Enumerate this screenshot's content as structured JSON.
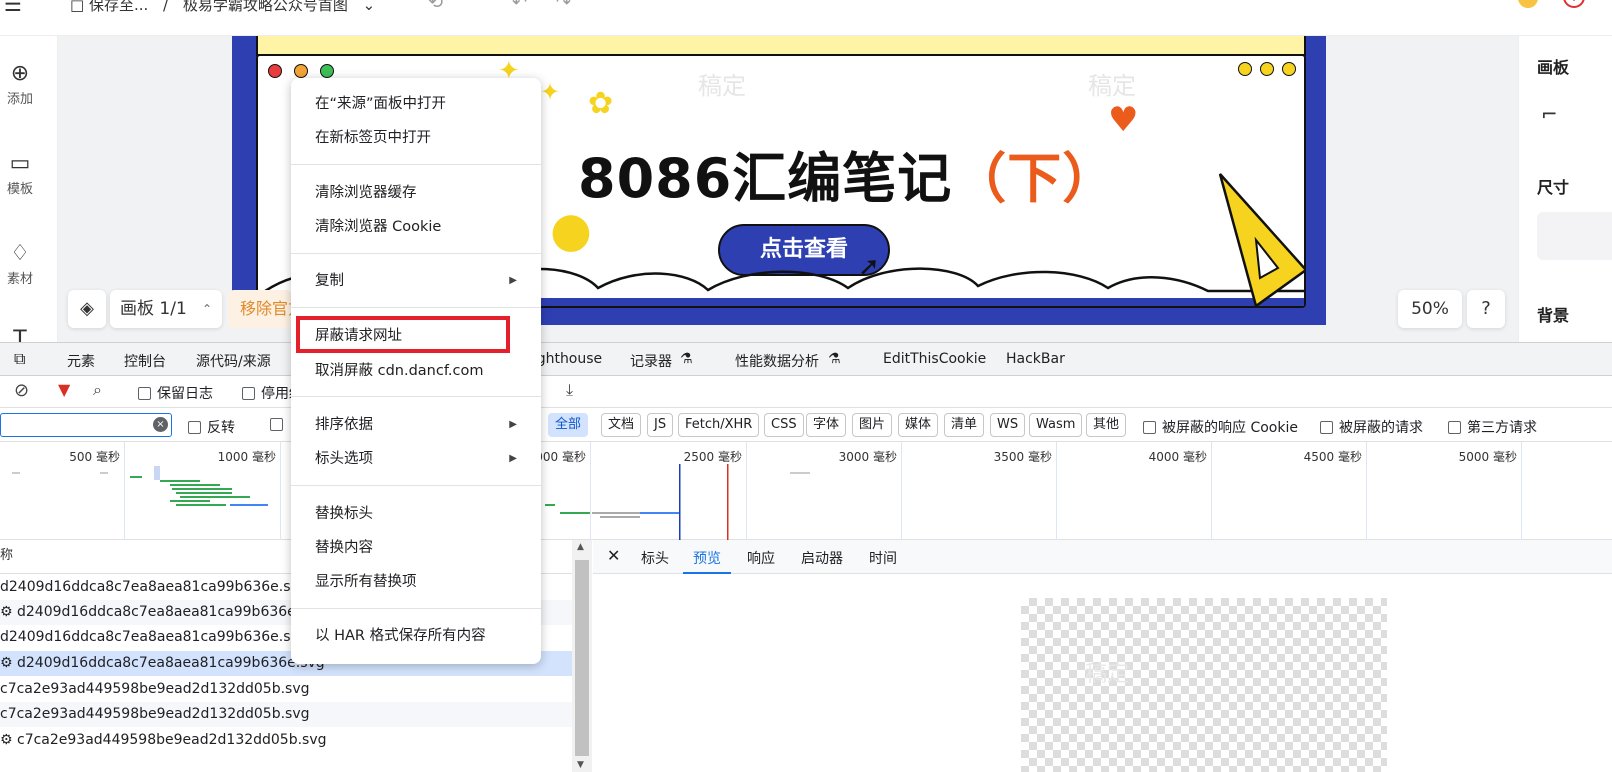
{
  "topbar": {
    "hamburger": "☰",
    "crumbs": [
      "□ 保存至...",
      "/",
      "极易学霸攻略公众号首图",
      "⌄"
    ]
  },
  "leftbar": {
    "items": [
      {
        "icon": "⊕",
        "label": "添加"
      },
      {
        "icon": "▭",
        "label": "模板"
      },
      {
        "icon": "♢",
        "label": "素材"
      },
      {
        "icon": "T",
        "label": ""
      }
    ]
  },
  "rightbar": {
    "panel": "画板",
    "size": "尺寸",
    "background": "背景"
  },
  "banner": {
    "title": "8086汇编笔记",
    "subtitle": "（下）",
    "cta": "点击查看",
    "watermark": "稿定"
  },
  "canvas_controls": {
    "board": "画板 1/1",
    "remove_watermark": "移除官方水印",
    "zoom": "50%",
    "help": "?"
  },
  "devtools": {
    "tabs": [
      "元素",
      "控制台",
      "源代码/来源",
      "Lighthouse",
      "记录器",
      "性能数据分析",
      "EditThisCookie",
      "HackBar"
    ],
    "toolbar": {
      "preserve_log": "保留日志",
      "disable_cache": "停用缓存"
    },
    "filter": {
      "invert": "反转",
      "types": [
        "全部",
        "文档",
        "JS",
        "Fetch/XHR",
        "CSS",
        "字体",
        "图片",
        "媒体",
        "清单",
        "WS",
        "Wasm",
        "其他"
      ],
      "blocked_cookies": "被屏蔽的响应 Cookie",
      "blocked_requests": "被屏蔽的请求",
      "third_party": "第三方请求"
    },
    "timeline_ticks": [
      "500 毫秒",
      "1000 毫秒",
      "2000 毫秒",
      "2500 毫秒",
      "3000 毫秒",
      "3500 毫秒",
      "4000 毫秒",
      "4500 毫秒",
      "5000 毫秒"
    ],
    "requests": {
      "header": "称",
      "rows": [
        "d2409d16ddca8c7ea8aea81ca99b636e.svg",
        "⚙ d2409d16ddca8c7ea8aea81ca99b636e.svg",
        "d2409d16ddca8c7ea8aea81ca99b636e.svg",
        "⚙ d2409d16ddca8c7ea8aea81ca99b636e.svg",
        "c7ca2e93ad449598be9ead2d132dd05b.svg",
        "c7ca2e93ad449598be9ead2d132dd05b.svg",
        "⚙ c7ca2e93ad449598be9ead2d132dd05b.svg"
      ]
    },
    "detail_tabs": [
      "标头",
      "预览",
      "响应",
      "启动器",
      "时间"
    ]
  },
  "context_menu": {
    "items": [
      {
        "label": "在“来源”面板中打开",
        "submenu": false
      },
      {
        "label": "在新标签页中打开",
        "submenu": false
      },
      {
        "label": "清除浏览器缓存",
        "submenu": false
      },
      {
        "label": "清除浏览器 Cookie",
        "submenu": false
      },
      {
        "label": "复制",
        "submenu": true
      },
      {
        "label": "屏蔽请求网址",
        "submenu": false
      },
      {
        "label": "取消屏蔽 cdn.dancf.com",
        "submenu": false
      },
      {
        "label": "排序依据",
        "submenu": true
      },
      {
        "label": "标头选项",
        "submenu": true
      },
      {
        "label": "替换标头",
        "submenu": false
      },
      {
        "label": "替换内容",
        "submenu": false
      },
      {
        "label": "显示所有替换项",
        "submenu": false
      },
      {
        "label": "以 HAR 格式保存所有内容",
        "submenu": false
      }
    ],
    "arrow": "▶"
  },
  "colors": {
    "accent": "#1a73e8",
    "highlight": "#e4202a",
    "brand_blue": "#2e3fb2",
    "orange": "#ea5b1c"
  }
}
